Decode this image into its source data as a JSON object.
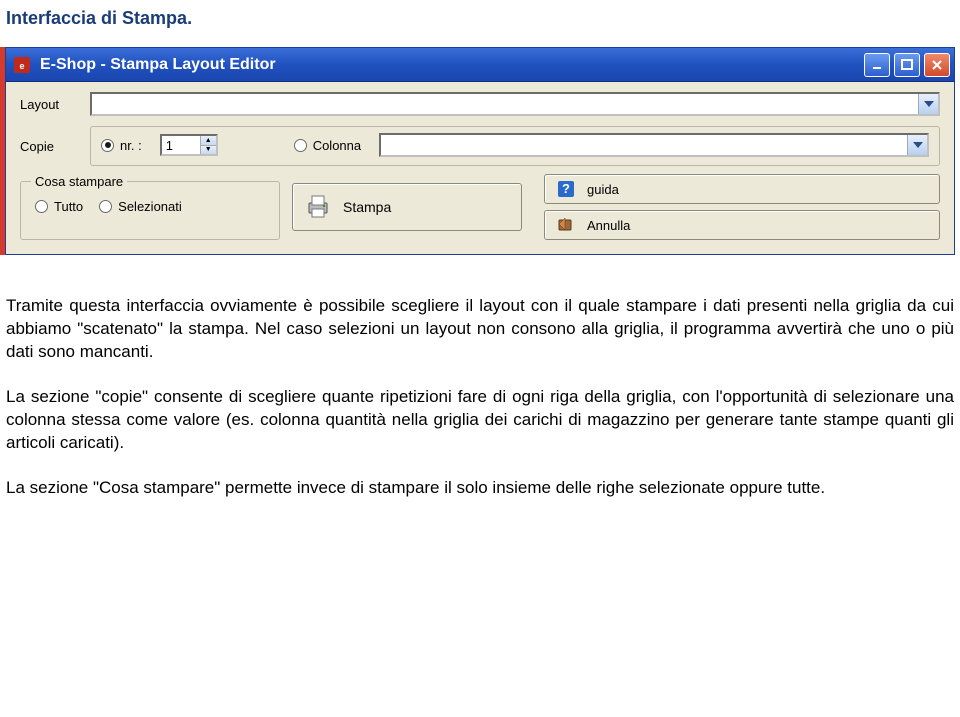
{
  "doc": {
    "title": "Interfaccia di Stampa.",
    "para1": "Tramite questa interfaccia ovviamente è possibile scegliere il layout con il quale stampare i dati presenti nella griglia da cui abbiamo \"scatenato\" la stampa. Nel caso selezioni un layout non consono alla griglia, il programma avvertirà che uno o più dati sono mancanti.",
    "para2": "La sezione \"copie\" consente di scegliere quante ripetizioni fare di ogni riga della griglia, con l'opportunità di selezionare una colonna stessa come valore (es. colonna quantità nella griglia dei carichi di magazzino per generare tante stampe quanti gli articoli caricati).",
    "para3": "La sezione \"Cosa stampare\" permette invece di stampare il solo insieme delle righe selezionate oppure tutte."
  },
  "window": {
    "title": "E-Shop - Stampa Layout Editor",
    "labels": {
      "layout": "Layout",
      "copie": "Copie",
      "nr": "nr. :",
      "colonna": "Colonna",
      "cosa_stampare": "Cosa stampare",
      "tutto": "Tutto",
      "selezionati": "Selezionati"
    },
    "values": {
      "layout_combo": "",
      "nr_spin": "1",
      "colonna_combo": ""
    },
    "buttons": {
      "stampa": "Stampa",
      "guida": "guida",
      "annulla": "Annulla"
    }
  }
}
